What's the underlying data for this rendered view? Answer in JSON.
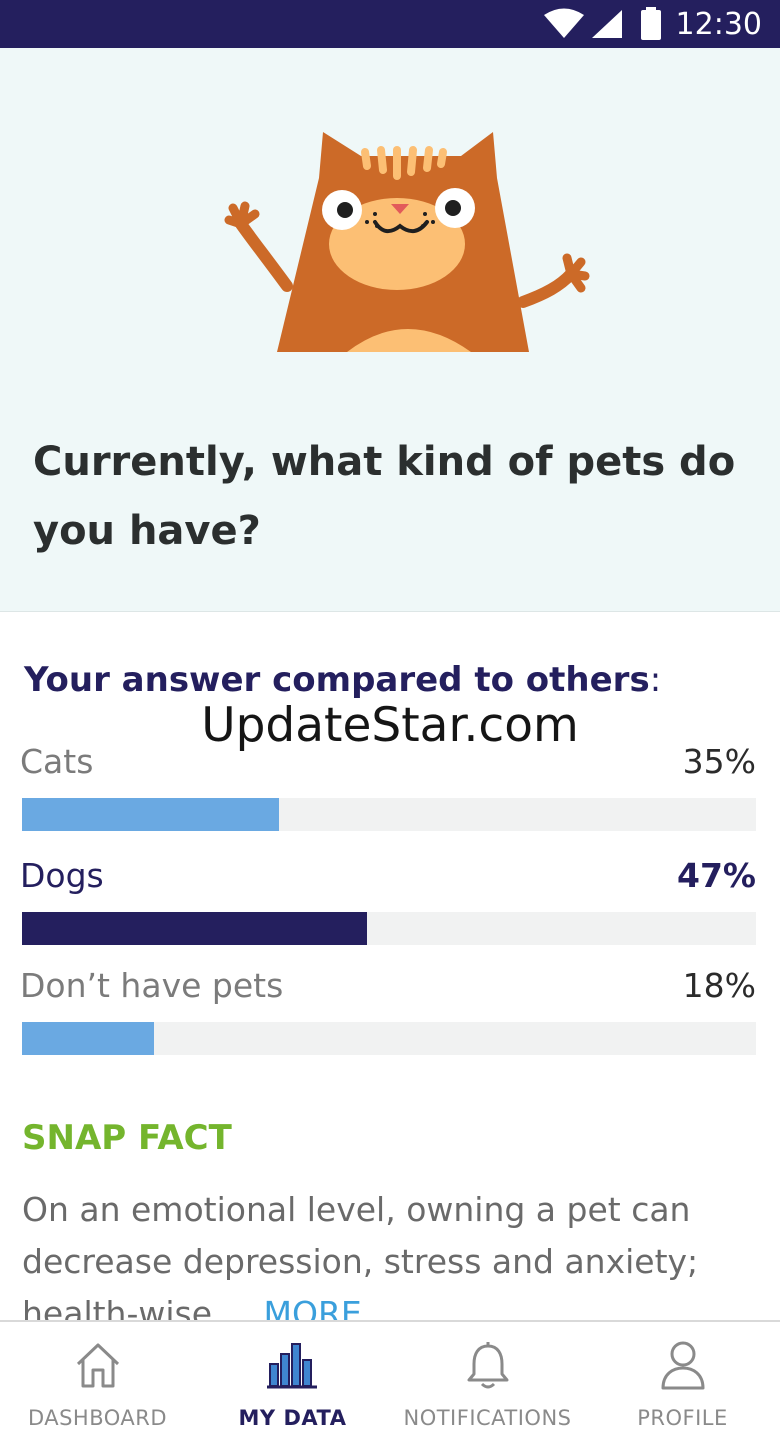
{
  "status_bar": {
    "time": "12:30"
  },
  "question": {
    "text": "Currently, what kind of pets do you have?"
  },
  "comparison": {
    "title": "Your answer compared to others",
    "title_suffix": ":",
    "watermark": "UpdateStar.com",
    "items": [
      {
        "label": "Cats",
        "value_text": "35%",
        "fraction": 0.35,
        "selected": false
      },
      {
        "label": "Dogs",
        "value_text": "47%",
        "fraction": 0.47,
        "selected": true
      },
      {
        "label": "Don’t have pets",
        "value_text": "18%",
        "fraction": 0.18,
        "selected": false
      }
    ]
  },
  "snap_fact": {
    "title": "SNAP FACT",
    "text": "On an emotional level, owning a pet can decrease depression, stress and anxiety; health-wise...",
    "more_label": "MORE"
  },
  "bottom_nav": {
    "items": [
      {
        "label": "DASHBOARD",
        "icon": "home-icon",
        "active": false
      },
      {
        "label": "MY DATA",
        "icon": "bar-chart-icon",
        "active": true
      },
      {
        "label": "NOTIFICATIONS",
        "icon": "bell-icon",
        "active": false
      },
      {
        "label": "PROFILE",
        "icon": "person-icon",
        "active": false
      }
    ]
  },
  "colors": {
    "brand_navy": "#241f5e",
    "bar_blue": "#6aa9e2",
    "snap_green": "#74b52d",
    "link_blue": "#3a9fdc",
    "hero_background": "#eff8f8"
  }
}
